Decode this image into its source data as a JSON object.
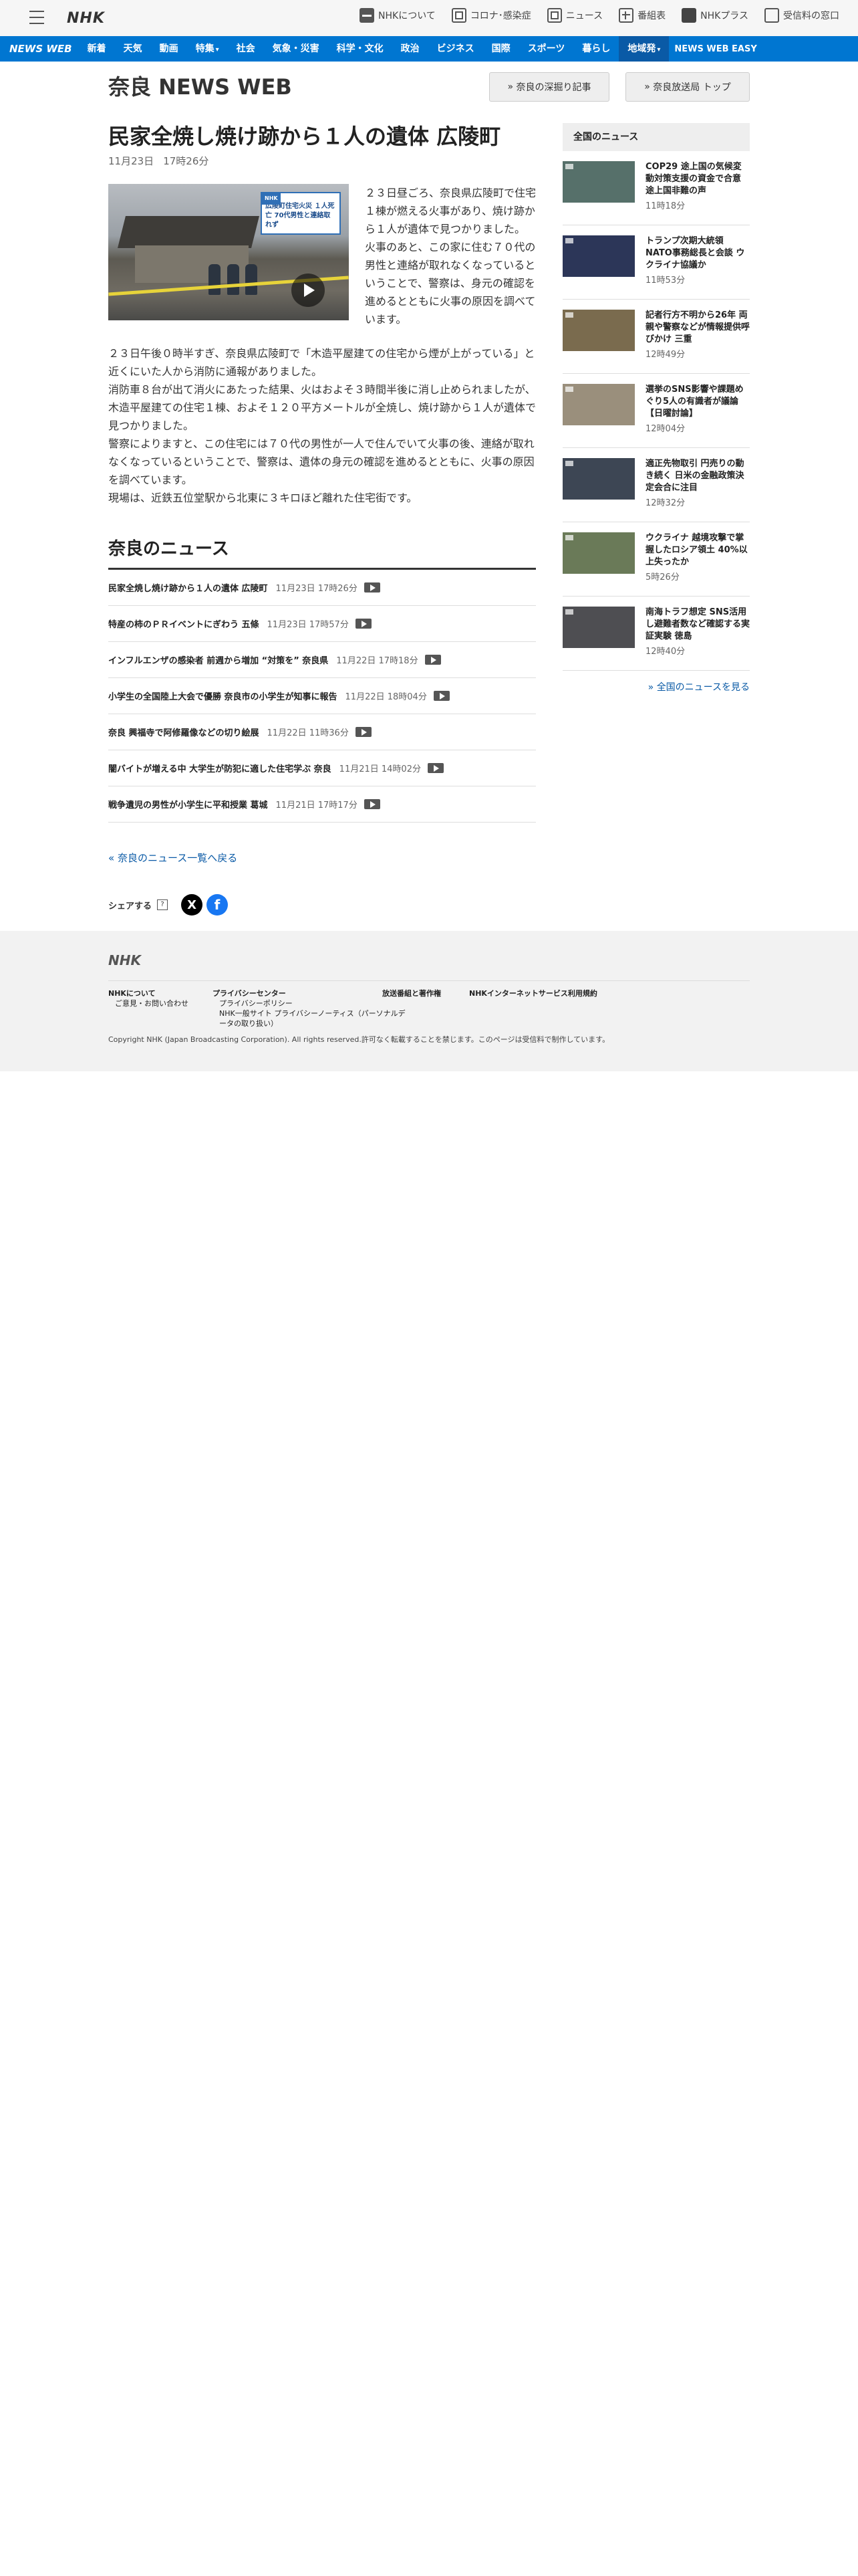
{
  "header": {
    "logo": "NHK",
    "links": [
      {
        "label": "NHKについて",
        "icon": "nhk-icon"
      },
      {
        "label": "コロナ･感染症",
        "icon": "virus-info-icon"
      },
      {
        "label": "ニュース",
        "icon": "news-icon"
      },
      {
        "label": "番組表",
        "icon": "program-guide-icon"
      },
      {
        "label": "NHKプラス",
        "icon": "nhk-plus-icon"
      },
      {
        "label": "受信料の窓口",
        "icon": "fee-window-icon"
      }
    ]
  },
  "nav": {
    "logo": "NEWS WEB",
    "items": [
      "新着",
      "天気",
      "動画",
      "特集",
      "社会",
      "気象・災害",
      "科学・文化",
      "政治",
      "ビジネス",
      "国際",
      "スポーツ",
      "暮らし",
      "地域発"
    ],
    "easy": "NEWS WEB EASY"
  },
  "subheader": {
    "title": "奈良 NEWS WEB",
    "btn_deep": "奈良の深掘り記事",
    "btn_top": "奈良放送局 トップ"
  },
  "article": {
    "title": "民家全焼し焼け跡から１人の遺体 広陵町",
    "date": "11月23日",
    "time": "17時26分",
    "image_caption": "広陵町住宅火災 １人死亡 70代男性と連絡取れず",
    "image_tag": "NHK",
    "lead": "２３日昼ごろ、奈良県広陵町で住宅１棟が燃える火事があり、焼け跡から１人が遺体で見つかりました。\n火事のあと、この家に住む７０代の男性と連絡が取れなくなっているということで、警察は、身元の確認を進めるとともに火事の原因を調べています。",
    "body": [
      "２３日午後０時半すぎ、奈良県広陵町で「木造平屋建ての住宅から煙が上がっている」と近くにいた人から消防に通報がありました。",
      "消防車８台が出て消火にあたった結果、火はおよそ３時間半後に消し止められましたが、木造平屋建ての住宅１棟、およそ１２０平方メートルが全焼し、焼け跡から１人が遺体で見つかりました。",
      "警察によりますと、この住宅には７０代の男性が一人で住んでいて火事の後、連絡が取れなくなっているということで、警察は、遺体の身元の確認を進めるとともに、火事の原因を調べています。",
      "現場は、近鉄五位堂駅から北東に３キロほど離れた住宅街です。"
    ]
  },
  "local_news": {
    "heading": "奈良のニュース",
    "items": [
      {
        "title": "民家全焼し焼け跡から１人の遺体 広陵町",
        "date": "11月23日 17時26分"
      },
      {
        "title": "特産の柿のＰＲイベントにぎわう 五條",
        "date": "11月23日 17時57分"
      },
      {
        "title": "インフルエンザの感染者 前週から増加 “対策を” 奈良県",
        "date": "11月22日 17時18分"
      },
      {
        "title": "小学生の全国陸上大会で優勝 奈良市の小学生が知事に報告",
        "date": "11月22日 18時04分"
      },
      {
        "title": "奈良 興福寺で阿修羅像などの切り絵展",
        "date": "11月22日 11時36分"
      },
      {
        "title": "闇バイトが増える中 大学生が防犯に適した住宅学ぶ 奈良",
        "date": "11月21日 14時02分"
      },
      {
        "title": "戦争遺児の男性が小学生に平和授業 葛城",
        "date": "11月21日 17時17分"
      }
    ],
    "back_link": "奈良のニュース一覧へ戻る"
  },
  "share": {
    "label": "シェアする",
    "help": "?",
    "x": "X",
    "fb": "f"
  },
  "sidebar": {
    "heading": "全国のニュース",
    "items": [
      {
        "title": "COP29 途上国の気候変動対策支援の資金で合意 途上国非難の声",
        "time": "11時18分",
        "thumb": "#56706a"
      },
      {
        "title": "トランプ次期大統領 NATO事務総長と会談 ウクライナ協議か",
        "time": "11時53分",
        "thumb": "#2c3658"
      },
      {
        "title": "記者行方不明から26年 両親や警察などが情報提供呼びかけ 三重",
        "time": "12時49分",
        "thumb": "#7a6b4e"
      },
      {
        "title": "選挙のSNS影響や課題めぐり5人の有識者が議論【日曜討論】",
        "time": "12時04分",
        "thumb": "#9a8f7c"
      },
      {
        "title": "適正先物取引 円売りの動き続く 日米の金融政策決定会合に注目",
        "time": "12時32分",
        "thumb": "#3d4654"
      },
      {
        "title": "ウクライナ 越境攻撃で掌握したロシア領土 40%以上失ったか",
        "time": "5時26分",
        "thumb": "#6a7a58"
      },
      {
        "title": "南海トラフ想定 SNS活用し避難者数など確認する実証実験 徳島",
        "time": "12時40分",
        "thumb": "#4e4e52"
      }
    ],
    "more": "全国のニュースを見る"
  },
  "footer": {
    "logo": "NHK",
    "col1": {
      "h": "NHKについて",
      "s": [
        "ご意見・お問い合わせ"
      ]
    },
    "col2": {
      "h": "プライバシーセンター",
      "s": [
        "プライバシーポリシー",
        "NHK一般サイト プライバシーノーティス（パーソナルデータの取り扱い）"
      ]
    },
    "col3": {
      "h": "放送番組と著作権",
      "s": []
    },
    "col4": {
      "h": "NHKインターネットサービス利用規約",
      "s": []
    },
    "copyright": "Copyright NHK (Japan Broadcasting Corporation). All rights reserved.許可なく転載することを禁じます。このページは受信料で制作しています。"
  },
  "colors": {
    "nav_blue": "#0076d1",
    "nav_active": "#0a5aa6",
    "link": "#0a5aa6",
    "footer_bg": "#f2f2f2"
  }
}
